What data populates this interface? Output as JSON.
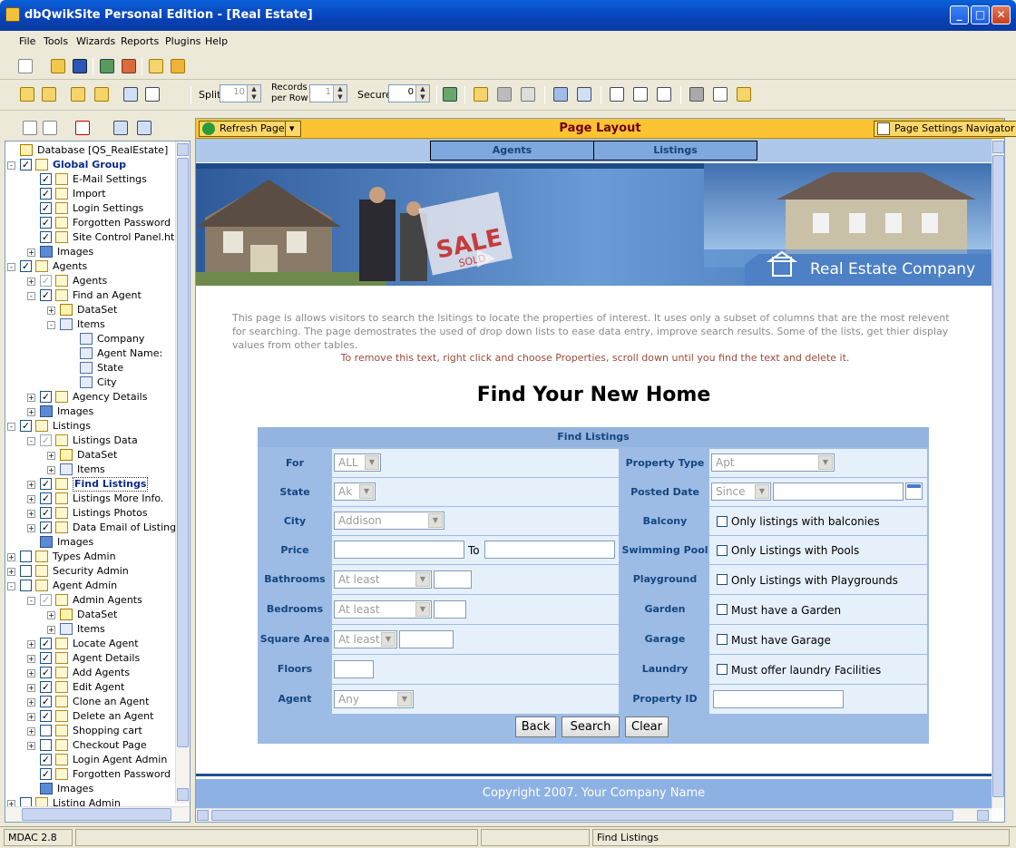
{
  "window": {
    "title": "dbQwikSite Personal Edition - [Real Estate]"
  },
  "menu": [
    "File",
    "Tools",
    "Wizards",
    "Reports",
    "Plugins",
    "Help"
  ],
  "toolbar2": {
    "split_label": "Split",
    "split_value": "10",
    "records_label_1": "Records",
    "records_label_2": "per Row",
    "records_value": "1",
    "secure_label": "Secure",
    "secure_value": "0"
  },
  "tree": [
    {
      "label": "Database [QS_RealEstate]",
      "level": 0,
      "exp": "",
      "cb": "none",
      "icon": "db"
    },
    {
      "label": "Global Group",
      "level": 0,
      "exp": "-",
      "cb": "checked",
      "icon": "page",
      "bold": true
    },
    {
      "label": "E-Mail Settings",
      "level": 1,
      "exp": "",
      "cb": "checked",
      "icon": "page"
    },
    {
      "label": "Import",
      "level": 1,
      "exp": "",
      "cb": "checked",
      "icon": "page"
    },
    {
      "label": "Login Settings",
      "level": 1,
      "exp": "",
      "cb": "checked",
      "icon": "page"
    },
    {
      "label": "Forgotten Password",
      "level": 1,
      "exp": "",
      "cb": "checked",
      "icon": "page"
    },
    {
      "label": "Site Control Panel.html",
      "level": 1,
      "exp": "",
      "cb": "checked",
      "icon": "page"
    },
    {
      "label": "Images",
      "level": 1,
      "exp": "+",
      "cb": "none",
      "icon": "img"
    },
    {
      "label": "Agents",
      "level": 0,
      "exp": "-",
      "cb": "checked",
      "icon": "page"
    },
    {
      "label": "Agents",
      "level": 1,
      "exp": "+",
      "cb": "dim",
      "icon": "page"
    },
    {
      "label": "Find an Agent",
      "level": 1,
      "exp": "-",
      "cb": "checked",
      "icon": "page"
    },
    {
      "label": "DataSet",
      "level": 2,
      "exp": "+",
      "cb": "none",
      "icon": "db"
    },
    {
      "label": "Items",
      "level": 2,
      "exp": "-",
      "cb": "none",
      "icon": "items"
    },
    {
      "label": "Company",
      "level": 3,
      "exp": "",
      "cb": "none",
      "icon": "items"
    },
    {
      "label": "Agent Name:",
      "level": 3,
      "exp": "",
      "cb": "none",
      "icon": "items"
    },
    {
      "label": "State",
      "level": 3,
      "exp": "",
      "cb": "none",
      "icon": "items"
    },
    {
      "label": "City",
      "level": 3,
      "exp": "",
      "cb": "none",
      "icon": "items"
    },
    {
      "label": "Agency Details",
      "level": 1,
      "exp": "+",
      "cb": "checked",
      "icon": "page"
    },
    {
      "label": "Images",
      "level": 1,
      "exp": "+",
      "cb": "none",
      "icon": "img"
    },
    {
      "label": "Listings",
      "level": 0,
      "exp": "-",
      "cb": "checked",
      "icon": "page"
    },
    {
      "label": "Listings Data",
      "level": 1,
      "exp": "-",
      "cb": "dim",
      "icon": "page"
    },
    {
      "label": "DataSet",
      "level": 2,
      "exp": "+",
      "cb": "none",
      "icon": "db"
    },
    {
      "label": "Items",
      "level": 2,
      "exp": "+",
      "cb": "none",
      "icon": "items"
    },
    {
      "label": "Find Listings",
      "level": 1,
      "exp": "+",
      "cb": "checked",
      "icon": "page",
      "selected": true
    },
    {
      "label": "Listings More Info.",
      "level": 1,
      "exp": "+",
      "cb": "checked",
      "icon": "page"
    },
    {
      "label": "Listings Photos",
      "level": 1,
      "exp": "+",
      "cb": "checked",
      "icon": "page"
    },
    {
      "label": "Data Email of Listings",
      "level": 1,
      "exp": "+",
      "cb": "checked",
      "icon": "page"
    },
    {
      "label": "Images",
      "level": 1,
      "exp": "",
      "cb": "none",
      "icon": "img"
    },
    {
      "label": "Types Admin",
      "level": 0,
      "exp": "+",
      "cb": "empty",
      "icon": "page"
    },
    {
      "label": "Security Admin",
      "level": 0,
      "exp": "+",
      "cb": "empty",
      "icon": "page"
    },
    {
      "label": "Agent Admin",
      "level": 0,
      "exp": "-",
      "cb": "empty",
      "icon": "page"
    },
    {
      "label": "Admin Agents",
      "level": 1,
      "exp": "-",
      "cb": "dim",
      "icon": "page"
    },
    {
      "label": "DataSet",
      "level": 2,
      "exp": "+",
      "cb": "none",
      "icon": "db"
    },
    {
      "label": "Items",
      "level": 2,
      "exp": "+",
      "cb": "none",
      "icon": "items"
    },
    {
      "label": "Locate Agent",
      "level": 1,
      "exp": "+",
      "cb": "checked",
      "icon": "page"
    },
    {
      "label": "Agent Details",
      "level": 1,
      "exp": "+",
      "cb": "checked",
      "icon": "page"
    },
    {
      "label": "Add Agents",
      "level": 1,
      "exp": "+",
      "cb": "checked",
      "icon": "page"
    },
    {
      "label": "Edit Agent",
      "level": 1,
      "exp": "+",
      "cb": "checked",
      "icon": "page"
    },
    {
      "label": "Clone an Agent",
      "level": 1,
      "exp": "+",
      "cb": "checked",
      "icon": "page"
    },
    {
      "label": "Delete an Agent",
      "level": 1,
      "exp": "+",
      "cb": "checked",
      "icon": "page"
    },
    {
      "label": "Shopping cart",
      "level": 1,
      "exp": "+",
      "cb": "empty",
      "icon": "page"
    },
    {
      "label": "Checkout Page",
      "level": 1,
      "exp": "+",
      "cb": "empty",
      "icon": "page"
    },
    {
      "label": "Login Agent Admin",
      "level": 1,
      "exp": "",
      "cb": "checked",
      "icon": "page"
    },
    {
      "label": "Forgotten Password",
      "level": 1,
      "exp": "",
      "cb": "checked",
      "icon": "page"
    },
    {
      "label": "Images",
      "level": 1,
      "exp": "",
      "cb": "none",
      "icon": "img"
    },
    {
      "label": "Listing Admin",
      "level": 0,
      "exp": "+",
      "cb": "empty",
      "icon": "page"
    }
  ],
  "editor": {
    "refresh_label": "Refresh Page",
    "page_title": "Page Layout",
    "navigator_label": "Page Settings Navigator"
  },
  "page": {
    "nav": [
      "Agents",
      "Listings"
    ],
    "banner_text": "Real Estate Company",
    "banner_sign": "SALE",
    "banner_sign2": "SOLD",
    "intro": "This page is allows visitors to search the lsitings to locate the properties of interest. It uses only a subset of columns that are the most relevent for searching. The page demostrates the used of drop down lists to ease data entry, improve search results. Some of the lists, get thier display values from other tables.",
    "intro2": "To remove this text, right click and choose Properties, scroll down until you find the text and delete it.",
    "heading": "Find Your New Home",
    "form_title": "Find Listings",
    "left": [
      {
        "label": "For",
        "value": "ALL"
      },
      {
        "label": "State",
        "value": "Ak"
      },
      {
        "label": "City",
        "value": "Addison"
      },
      {
        "label": "Price",
        "to": "To"
      },
      {
        "label": "Bathrooms",
        "value": "At least"
      },
      {
        "label": "Bedrooms",
        "value": "At least"
      },
      {
        "label": "Square Area",
        "value": "At least"
      },
      {
        "label": "Floors"
      },
      {
        "label": "Agent",
        "value": "Any"
      }
    ],
    "right": [
      {
        "label": "Property Type",
        "value": "Apt"
      },
      {
        "label": "Posted Date",
        "value": "Since"
      },
      {
        "label": "Balcony",
        "check": "Only listings with balconies"
      },
      {
        "label": "Swimming Pool",
        "check": "Only Listings with Pools"
      },
      {
        "label": "Playground",
        "check": "Only Listings with Playgrounds"
      },
      {
        "label": "Garden",
        "check": "Must have a Garden"
      },
      {
        "label": "Garage",
        "check": "Must have Garage"
      },
      {
        "label": "Laundry",
        "check": "Must offer laundry Facilities"
      },
      {
        "label": "Property ID"
      }
    ],
    "buttons": [
      "Back",
      "Search",
      "Clear"
    ],
    "footer": "Copyright 2007. Your Company Name"
  },
  "status": {
    "left": "MDAC 2.8",
    "right": "Find Listings"
  }
}
